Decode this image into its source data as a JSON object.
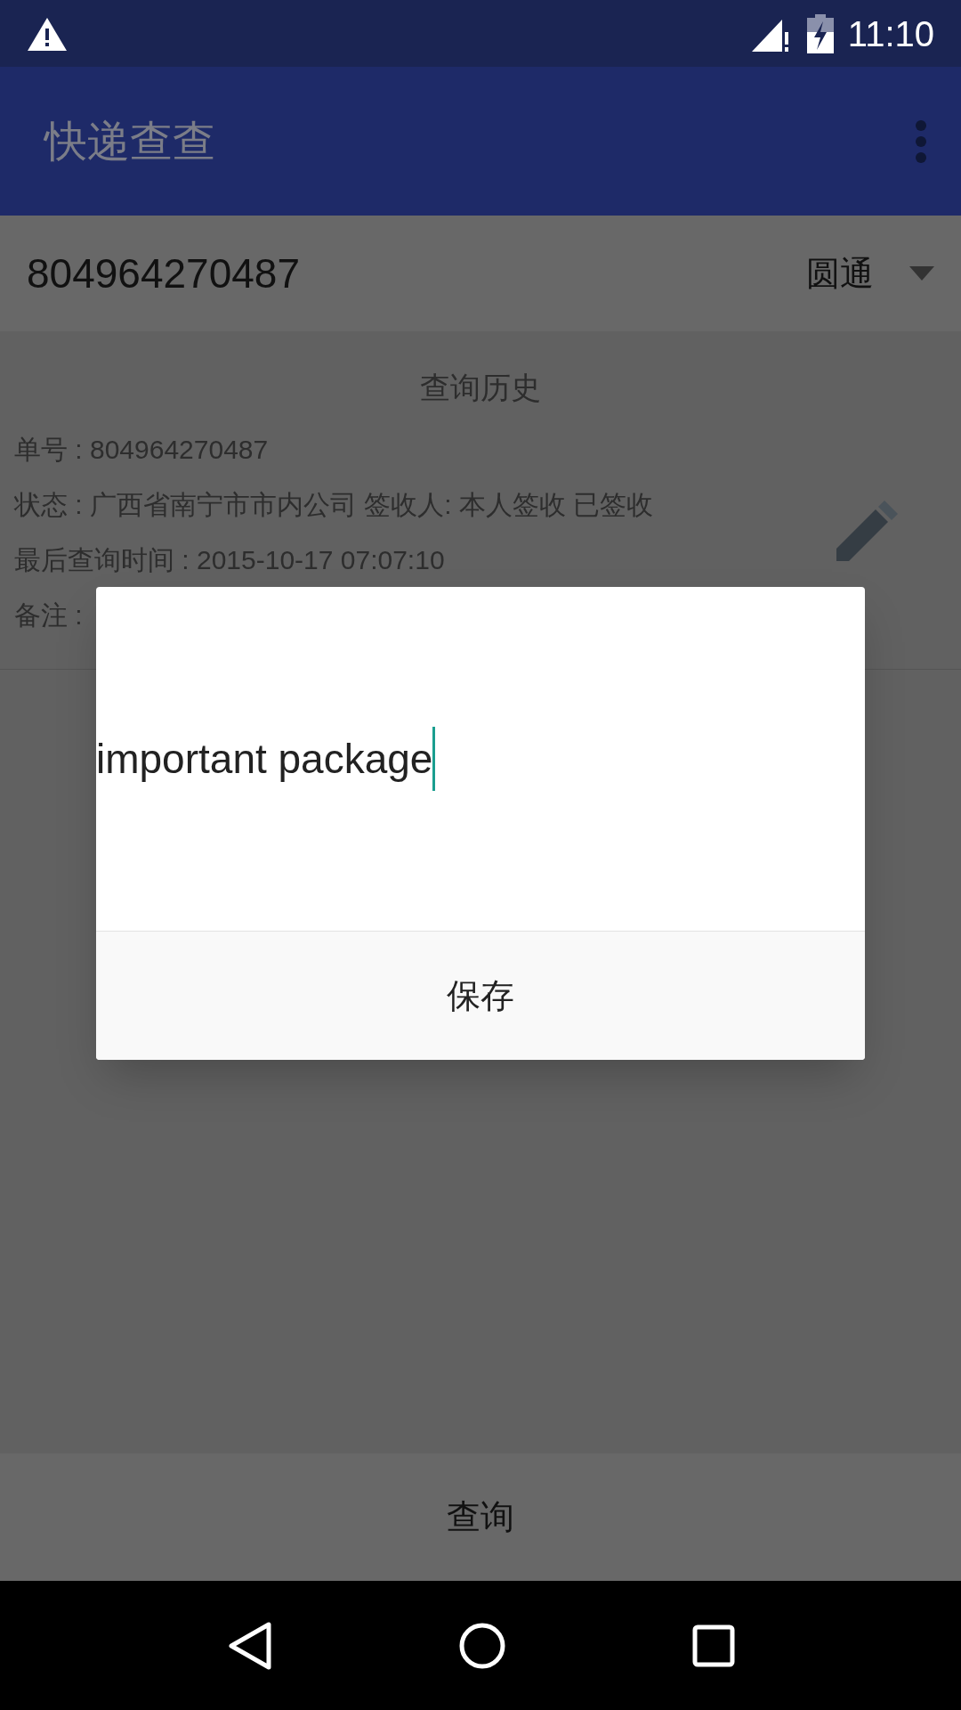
{
  "status_bar": {
    "time": "11:10"
  },
  "app_bar": {
    "title": "快递查查"
  },
  "query": {
    "tracking_number": "804964270487",
    "carrier": "圆通"
  },
  "history": {
    "title": "查询历史",
    "lines": [
      "单号 : 804964270487",
      "状态 : 广西省南宁市市内公司 签收人: 本人签收 已签收",
      "最后查询时间 : 2015-10-17 07:07:10",
      "备注 :"
    ]
  },
  "dialog": {
    "value": "important package",
    "button": "保存"
  },
  "query_button": "查询"
}
